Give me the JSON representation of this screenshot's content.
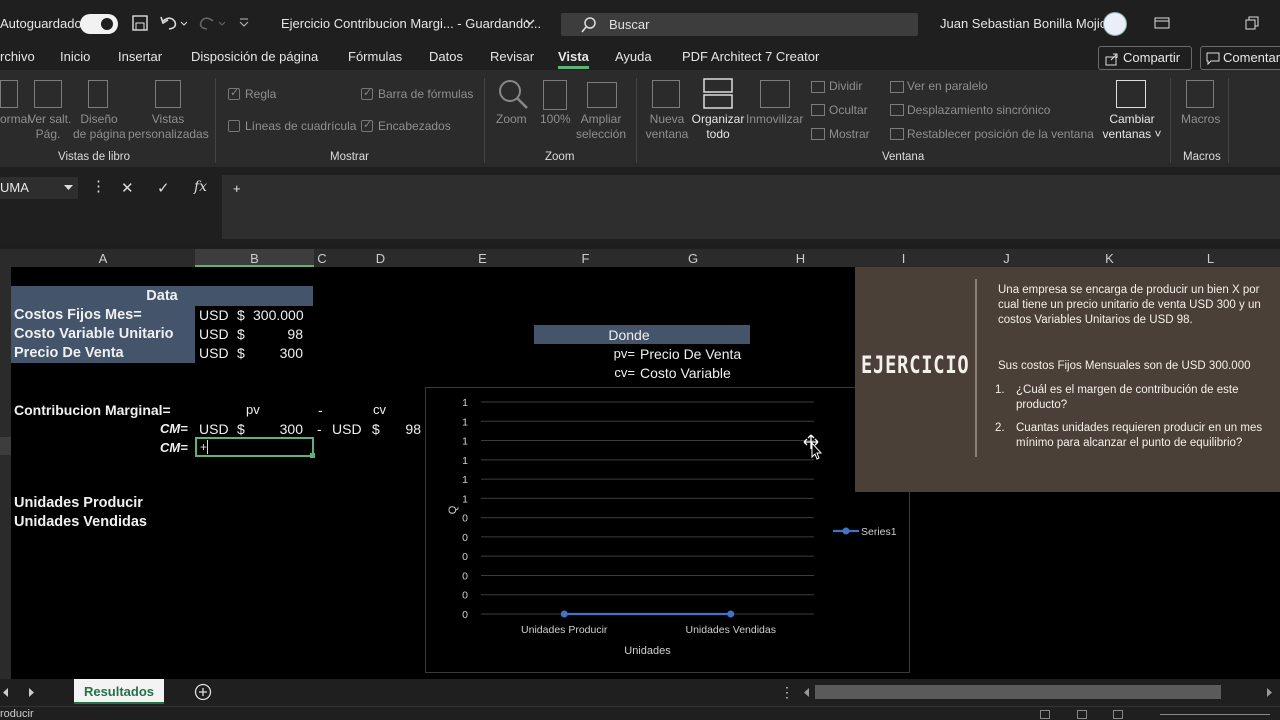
{
  "titlebar": {
    "autosave": "Autoguardado",
    "doc_title": "Ejercicio Contribucion Margi...  -  Guardando...",
    "search_placeholder": "Buscar",
    "user": "Juan Sebastian Bonilla Mojica"
  },
  "menu": {
    "items": [
      "rchivo",
      "Inicio",
      "Insertar",
      "Disposición de página",
      "Fórmulas",
      "Datos",
      "Revisar",
      "Vista",
      "Ayuda",
      "PDF Architect 7 Creator"
    ],
    "active": "Vista",
    "share": "Compartir",
    "comment": "Comentar"
  },
  "ribbon": {
    "vistas": {
      "items": [
        "ormal",
        "Ver salt.\nPág.",
        "Diseño\nde página",
        "Vistas\npersonalizadas"
      ],
      "group": "Vistas de libro"
    },
    "mostrar": {
      "regla": "Regla",
      "barra": "Barra de fórmulas",
      "lineas": "Líneas de cuadrícula",
      "encabezados": "Encabezados",
      "group": "Mostrar"
    },
    "zoom": {
      "zoom": "Zoom",
      "pct": "100%",
      "ampliar": "Ampliar\nselección",
      "group": "Zoom"
    },
    "ventana": {
      "nueva": "Nueva\nventana",
      "organizar": "Organizar\ntodo",
      "inmovilizar": "Inmovilizar",
      "dividir": "Dividir",
      "ocultar": "Ocultar",
      "mostrar": "Mostrar",
      "paralelo": "Ver en paralelo",
      "sincronico": "Desplazamiento sincrónico",
      "restablecer": "Restablecer posición de la ventana",
      "cambiar": "Cambiar\nventanas",
      "group": "Ventana"
    },
    "macros": {
      "macros": "Macros",
      "group": "Macros"
    }
  },
  "formula_bar": {
    "namebox": "UMA",
    "content": "+"
  },
  "columns": [
    "A",
    "B",
    "C",
    "D",
    "E",
    "F",
    "G",
    "H",
    "I",
    "J",
    "K",
    "L"
  ],
  "cells": {
    "data_header": "Data",
    "r1_label": "Costos Fijos Mes=",
    "r2_label": "Costo Variable Unitario",
    "r3_label": "Precio De Venta",
    "usd": "USD",
    "dollar": "$",
    "r1_val": "300.000",
    "r2_val": "98",
    "r3_val": "300",
    "cm_label": "Contribucion Marginal=",
    "pv": "pv",
    "minus": "-",
    "cv": "cv",
    "cm": "CM=",
    "cm_pv": "300",
    "cm_cv": "98",
    "editing": "+",
    "unid_prod": "Unidades Producir",
    "unid_vend": "Unidades Vendidas",
    "donde": "Donde",
    "pv_def_key": "pv=",
    "pv_def_val": "Precio De Venta",
    "cv_def_key": "cv=",
    "cv_def_val": "Costo  Variable"
  },
  "chart_data": {
    "type": "line",
    "categories": [
      "Unidades Producir",
      "Unidades Vendidas"
    ],
    "series": [
      {
        "name": "Series1",
        "values": [
          0,
          0
        ],
        "color": "#4472c4"
      }
    ],
    "y_tick_labels": [
      "0",
      "0",
      "0",
      "0",
      "0",
      "0",
      "1",
      "1",
      "1",
      "1",
      "1",
      "1"
    ],
    "xlabel": "Unidades",
    "ylabel": "Q",
    "grid": true,
    "legend": "right"
  },
  "exercise": {
    "title": "EJERCICIO",
    "p1": "Una empresa se encarga de producir un bien X por cual tiene  un precio unitario de venta USD 300 y un costos Variables Unitarios de USD 98.",
    "p2": "Sus costos Fijos Mensuales son de USD 300.000",
    "q1_num": "1.",
    "q1": "¿Cuál es el margen de contribución de este producto?",
    "q2_num": "2.",
    "q2": "Cuantas unidades requieren producir en un mes mínimo para alcanzar el punto de equilibrio?"
  },
  "sheet_tab": "Resultados",
  "status": "roducir"
}
